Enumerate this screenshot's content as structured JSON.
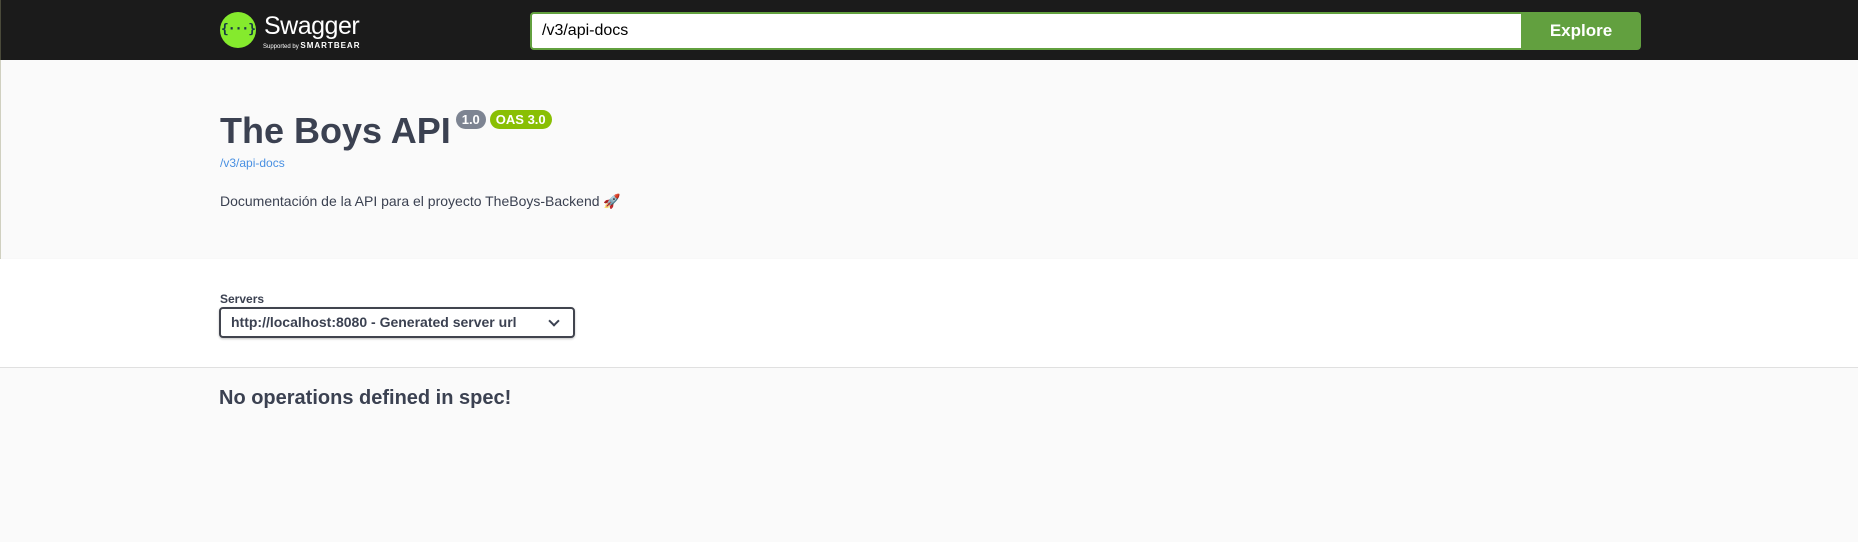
{
  "topbar": {
    "logo_mark": "{···}",
    "logo_name": "Swagger",
    "logo_sub_prefix": "Supported by",
    "logo_sub_brand": "SMARTBEAR",
    "url_value": "/v3/api-docs",
    "explore_label": "Explore"
  },
  "info": {
    "title": "The Boys API",
    "version": "1.0",
    "oas": "OAS 3.0",
    "spec_url": "/v3/api-docs",
    "description": "Documentación de la API para el proyecto TheBoys-Backend 🚀"
  },
  "servers": {
    "label": "Servers",
    "selected": "http://localhost:8080 - Generated server url"
  },
  "operations": {
    "empty_message": "No operations defined in spec!"
  },
  "colors": {
    "topbar_bg": "#1b1b1b",
    "accent_green": "#62a03f",
    "logo_green": "#85ea2d",
    "oas_badge": "#89bf04",
    "version_badge": "#7d8492",
    "link_blue": "#4990e2",
    "text": "#3b4151"
  }
}
